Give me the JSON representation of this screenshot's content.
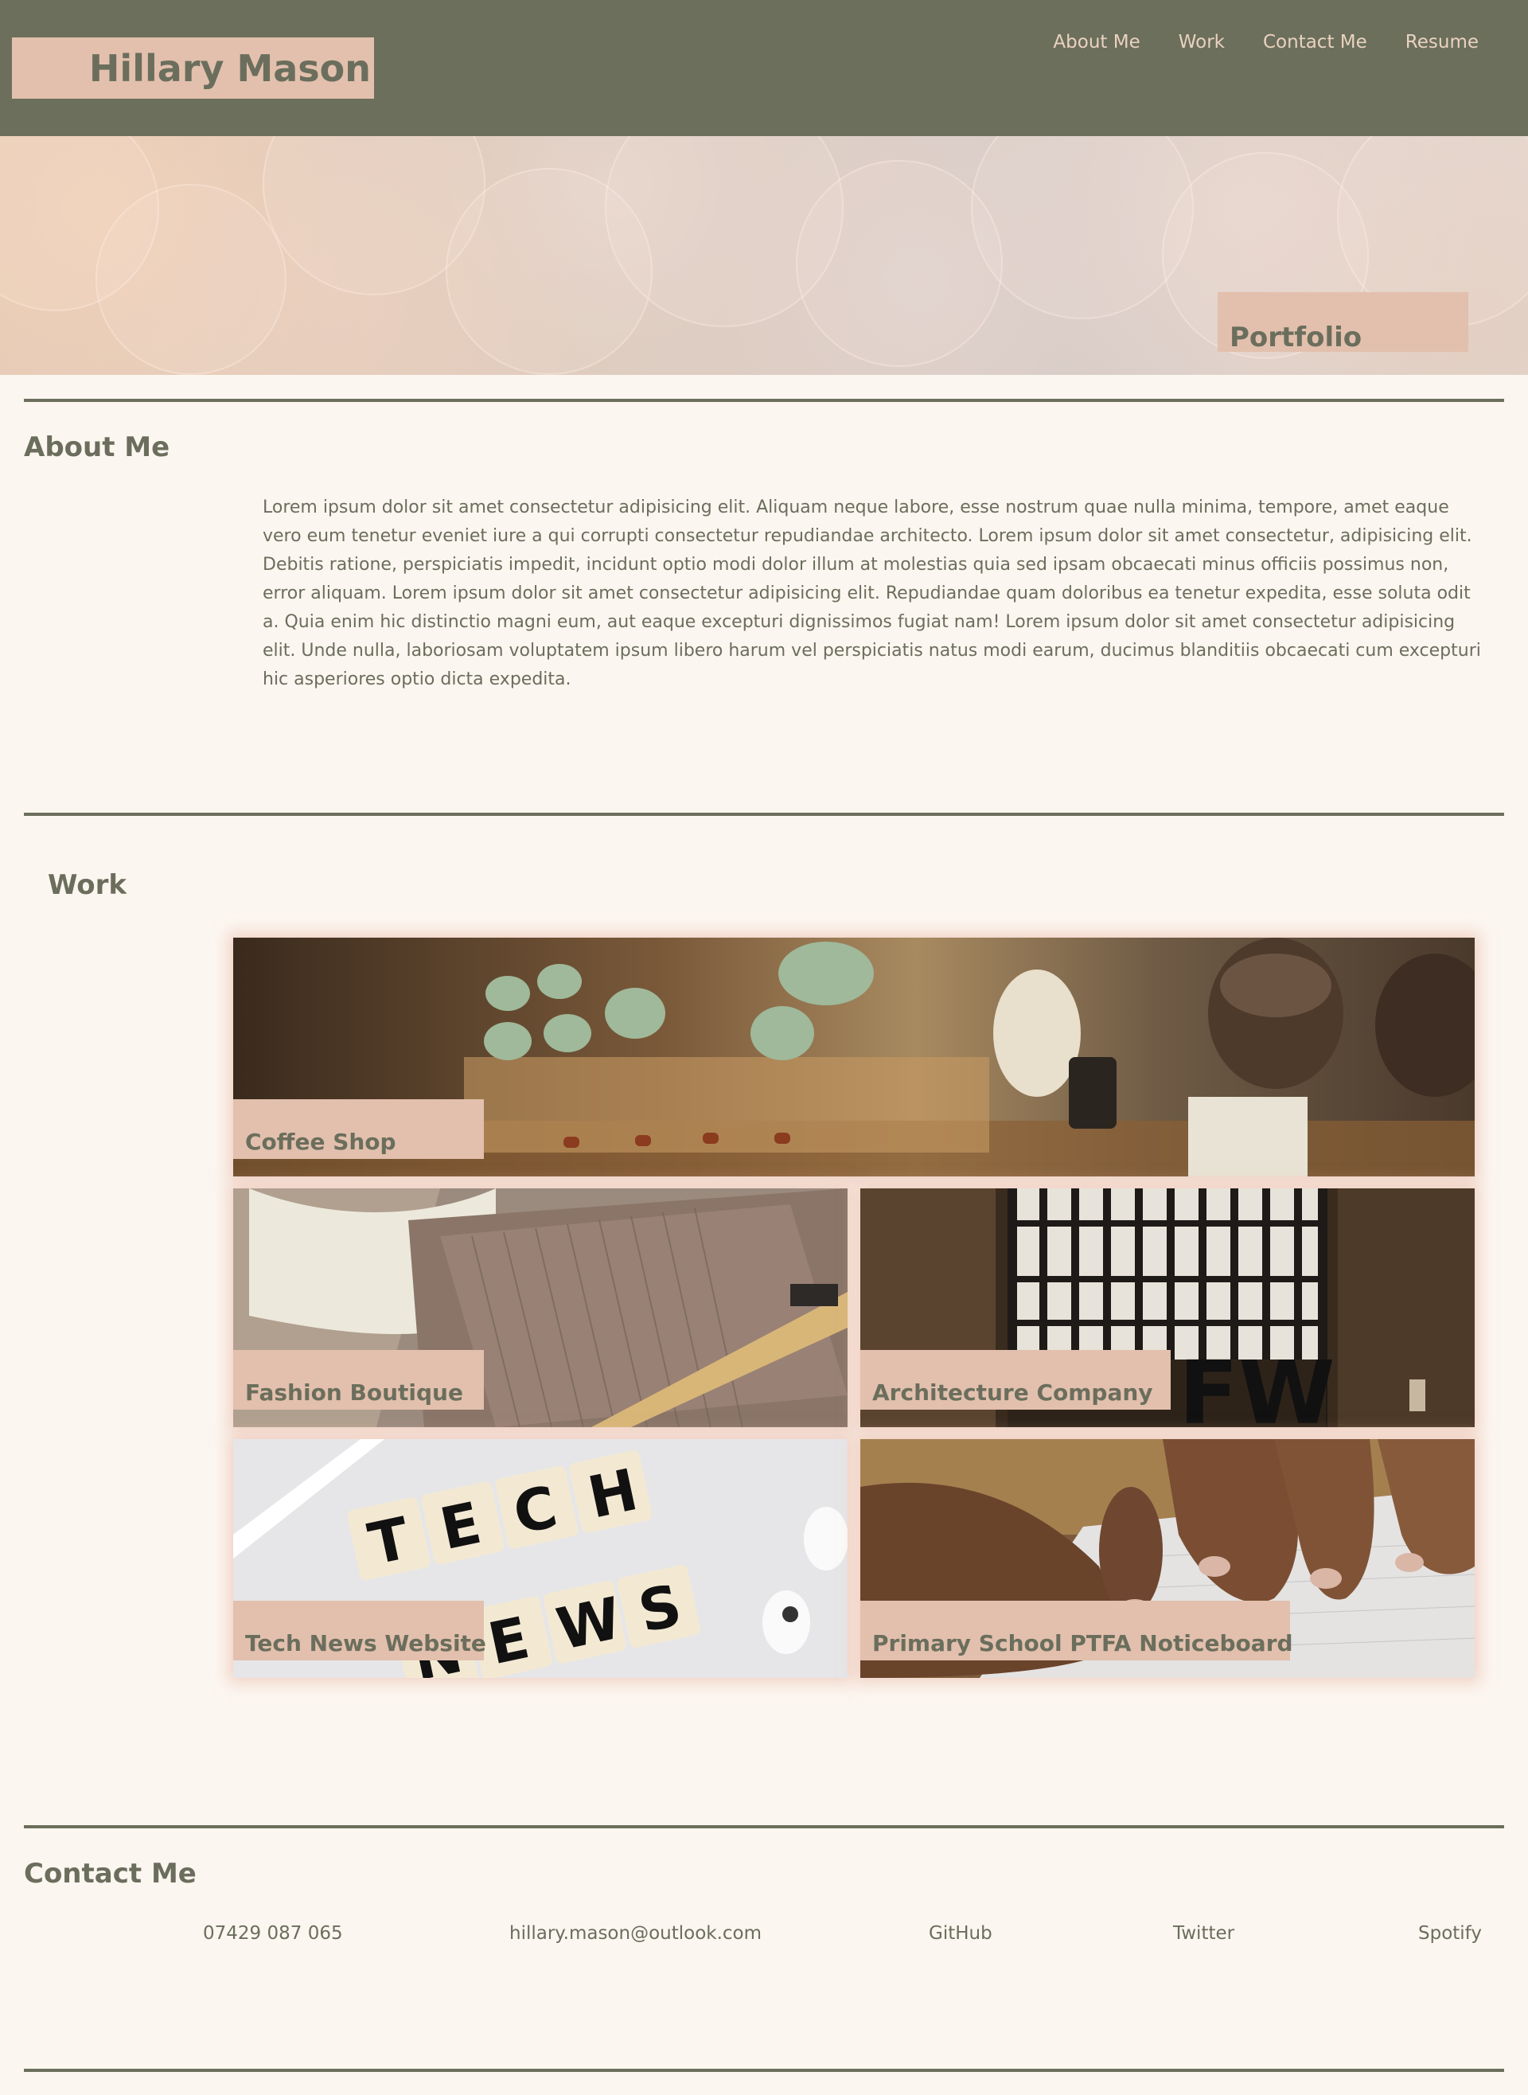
{
  "header": {
    "site_title": "Hillary Mason",
    "nav": [
      "About Me",
      "Work",
      "Contact Me",
      "Resume"
    ]
  },
  "hero": {
    "label": "Portfolio"
  },
  "about": {
    "title": "About Me",
    "text": "Lorem ipsum dolor sit amet consectetur adipisicing elit. Aliquam neque labore, esse nostrum quae nulla minima, tempore, amet eaque vero eum tenetur eveniet iure a qui corrupti consectetur repudiandae architecto. Lorem ipsum dolor sit amet consectetur, adipisicing elit. Debitis ratione, perspiciatis impedit, incidunt optio modi dolor illum at molestias quia sed ipsam obcaecati minus officiis possimus non, error aliquam. Lorem ipsum dolor sit amet consectetur adipisicing elit. Repudiandae quam doloribus ea tenetur expedita, esse soluta odit a. Quia enim hic distinctio magni eum, aut eaque excepturi dignissimos fugiat nam! Lorem ipsum dolor sit amet consectetur adipisicing elit. Unde nulla, laboriosam voluptatem ipsum libero harum vel perspiciatis natus modi earum, ducimus blanditiis obcaecati cum excepturi hic asperiores optio dicta expedita."
  },
  "work": {
    "title": "Work",
    "projects": [
      {
        "label": "Coffee Shop"
      },
      {
        "label": "Fashion Boutique"
      },
      {
        "label": "Architecture Company"
      },
      {
        "label": "Tech News Website"
      },
      {
        "label": "Primary School PTFA Noticeboard"
      }
    ]
  },
  "contact": {
    "title": "Contact Me",
    "phone": "07429 087 065",
    "email": "hillary.mason@outlook.com",
    "links": [
      "GitHub",
      "Twitter",
      "Spotify"
    ]
  },
  "colors": {
    "header_bg": "#6b6f5c",
    "accent_label_bg": "#e2c0ad",
    "page_bg": "#fcf6f0",
    "text": "#6b6e5c",
    "nav_text": "#ead2bf"
  }
}
